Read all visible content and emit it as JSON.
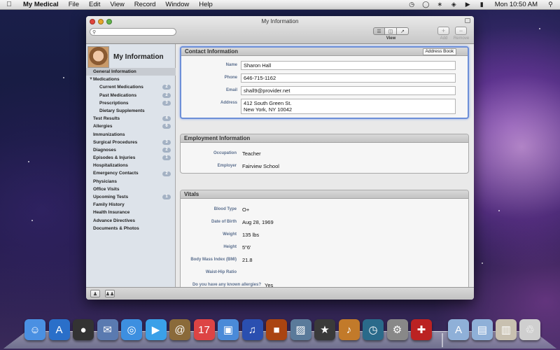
{
  "menubar": {
    "app_name": "My Medical",
    "items": [
      "File",
      "Edit",
      "View",
      "Record",
      "Window",
      "Help"
    ],
    "clock": "Mon 10:50 AM"
  },
  "window": {
    "title": "My Information",
    "search_placeholder": "",
    "view_label": "View",
    "add_label": "Add",
    "remove_label": "Remove"
  },
  "sidebar": {
    "profile_title": "My Information",
    "items": [
      {
        "label": "General Information",
        "indent": false,
        "selected": true,
        "badge": ""
      },
      {
        "label": "Medications",
        "indent": false,
        "expanded": true,
        "badge": ""
      },
      {
        "label": "Current Medications",
        "indent": true,
        "badge": "2"
      },
      {
        "label": "Past Medications",
        "indent": true,
        "badge": "2"
      },
      {
        "label": "Prescriptions",
        "indent": true,
        "badge": "3"
      },
      {
        "label": "Dietary Supplements",
        "indent": true,
        "badge": ""
      },
      {
        "label": "Test Results",
        "indent": false,
        "badge": "4"
      },
      {
        "label": "Allergies",
        "indent": false,
        "badge": "6"
      },
      {
        "label": "Immunizations",
        "indent": false,
        "badge": ""
      },
      {
        "label": "Surgical Procedures",
        "indent": false,
        "badge": "3"
      },
      {
        "label": "Diagnoses",
        "indent": false,
        "badge": "2"
      },
      {
        "label": "Episodes & Injuries",
        "indent": false,
        "badge": "1"
      },
      {
        "label": "Hospitalizations",
        "indent": false,
        "badge": ""
      },
      {
        "label": "Emergency Contacts",
        "indent": false,
        "badge": "2"
      },
      {
        "label": "Physicians",
        "indent": false,
        "badge": ""
      },
      {
        "label": "Office Visits",
        "indent": false,
        "badge": ""
      },
      {
        "label": "Upcoming Tests",
        "indent": false,
        "badge": "1"
      },
      {
        "label": "Family History",
        "indent": false,
        "badge": ""
      },
      {
        "label": "Health Insurance",
        "indent": false,
        "badge": ""
      },
      {
        "label": "Advance Directives",
        "indent": false,
        "badge": ""
      },
      {
        "label": "Documents & Photos",
        "indent": false,
        "badge": ""
      }
    ]
  },
  "contact": {
    "header": "Contact Information",
    "address_book_button": "Address Book",
    "name_label": "Name",
    "name_value": "Sharon Hall",
    "phone_label": "Phone",
    "phone_value": "646-715-1162",
    "email_label": "Email",
    "email_value": "shall9@provider.net",
    "address_label": "Address",
    "address_line1": "412 South Green St.",
    "address_line2": "New York, NY 10042"
  },
  "employment": {
    "header": "Employment Information",
    "occupation_label": "Occupation",
    "occupation_value": "Teacher",
    "employer_label": "Employer",
    "employer_value": "Fairview School"
  },
  "vitals": {
    "header": "Vitals",
    "blood_type_label": "Blood Type",
    "blood_type_value": "O+",
    "dob_label": "Date of Birth",
    "dob_value": "Aug 28, 1969",
    "weight_label": "Weight",
    "weight_value": "135 lbs",
    "height_label": "Height",
    "height_value": "5\"6'",
    "bmi_label": "Body Mass Index (BMI)",
    "bmi_value": "21.8",
    "whr_label": "Waist-Hip Ratio",
    "whr_value": "",
    "allergies_label": "Do you have any known allergies?",
    "allergies_value": "Yes"
  },
  "dock": {
    "icons": [
      "finder-icon",
      "app-store-icon",
      "dashboard-icon",
      "mail-icon",
      "safari-icon",
      "facetime-icon",
      "address-book-icon",
      "ical-icon",
      "preview-icon",
      "itunes-icon",
      "photo-booth-icon",
      "iphoto-icon",
      "imovie-icon",
      "garageband-icon",
      "time-machine-icon",
      "system-preferences-icon",
      "my-medical-icon",
      "applications-folder-icon",
      "documents-folder-icon",
      "downloads-stack-icon",
      "trash-icon"
    ],
    "colors": [
      "#4a90e2",
      "#2a6fc9",
      "#333333",
      "#5a7ab0",
      "#3d8fe0",
      "#3aa0e8",
      "#8a6a3a",
      "#d44",
      "#4a8ad8",
      "#2a4fb0",
      "#a41",
      "#5a7a9a",
      "#3a3a3a",
      "#c27a2a",
      "#2a6a8a",
      "#888888",
      "#b22",
      "#8fb0d8",
      "#8fb0d8",
      "#c8c0b0",
      "#cfcfcf"
    ]
  }
}
